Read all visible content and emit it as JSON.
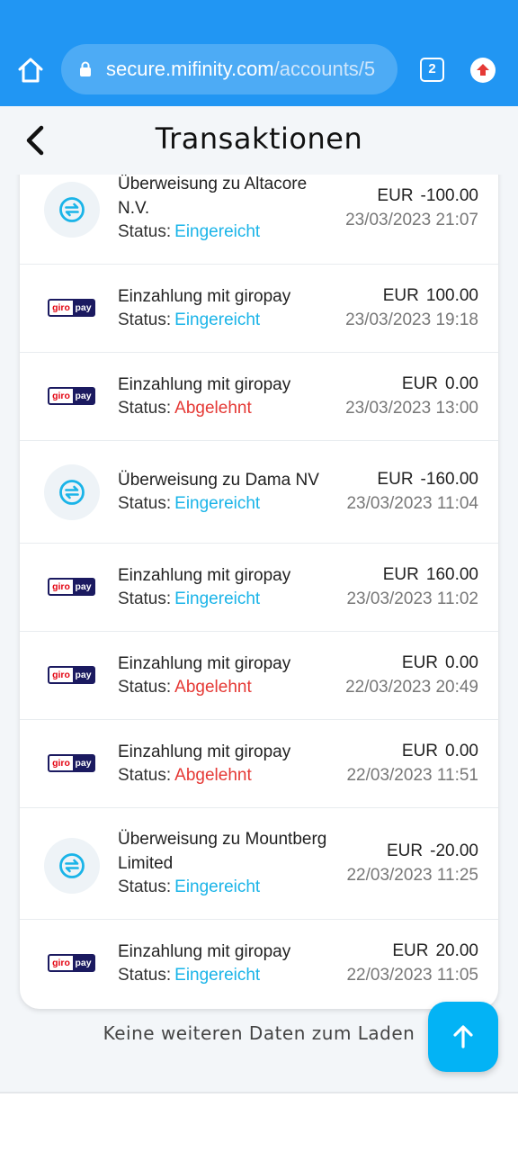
{
  "browser": {
    "url_host": "secure.mifinity.com",
    "url_path": "/accounts/5",
    "tab_count": "2"
  },
  "header": {
    "title": "Transaktionen"
  },
  "status_label": "Status:",
  "transactions": [
    {
      "icon": "transfer-icon",
      "title": "Überweisung zu Altacore N.V.",
      "status": "Eingereicht",
      "currency": "EUR",
      "amount": "-100.00",
      "date": "23/03/2023 21:07"
    },
    {
      "icon": "giropay-logo",
      "title": "Einzahlung mit giropay",
      "status": "Eingereicht",
      "currency": "EUR",
      "amount": "100.00",
      "date": "23/03/2023 19:18"
    },
    {
      "icon": "giropay-logo",
      "title": "Einzahlung mit giropay",
      "status": "Abgelehnt",
      "currency": "EUR",
      "amount": "0.00",
      "date": "23/03/2023 13:00"
    },
    {
      "icon": "transfer-icon",
      "title": "Überweisung zu Dama NV",
      "status": "Eingereicht",
      "currency": "EUR",
      "amount": "-160.00",
      "date": "23/03/2023 11:04"
    },
    {
      "icon": "giropay-logo",
      "title": "Einzahlung mit giropay",
      "status": "Eingereicht",
      "currency": "EUR",
      "amount": "160.00",
      "date": "23/03/2023 11:02"
    },
    {
      "icon": "giropay-logo",
      "title": "Einzahlung mit giropay",
      "status": "Abgelehnt",
      "currency": "EUR",
      "amount": "0.00",
      "date": "22/03/2023 20:49"
    },
    {
      "icon": "giropay-logo",
      "title": "Einzahlung mit giropay",
      "status": "Abgelehnt",
      "currency": "EUR",
      "amount": "0.00",
      "date": "22/03/2023 11:51"
    },
    {
      "icon": "transfer-icon",
      "title": "Überweisung zu Mountberg Limited",
      "status": "Eingereicht",
      "currency": "EUR",
      "amount": "-20.00",
      "date": "22/03/2023 11:25"
    },
    {
      "icon": "giropay-logo",
      "title": "Einzahlung mit giropay",
      "status": "Eingereicht",
      "currency": "EUR",
      "amount": "20.00",
      "date": "22/03/2023 11:05"
    }
  ],
  "footer": {
    "end_message": "Keine weiteren Daten zum Laden"
  },
  "giropay_logo_text": {
    "left": "giro",
    "right": "pay"
  },
  "colors": {
    "browser_bar": "#2196f3",
    "status_submitted": "#1ab4e8",
    "status_rejected": "#e53935",
    "fab": "#03b3f5"
  }
}
